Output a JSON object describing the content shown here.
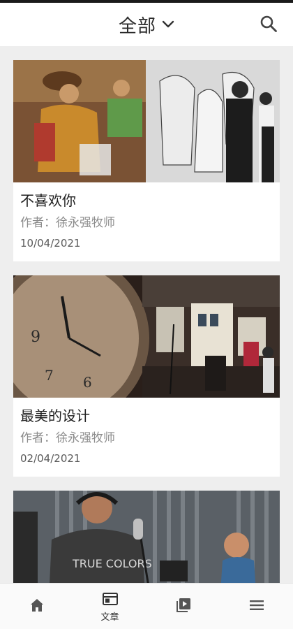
{
  "header": {
    "title": "全部",
    "dropdown_icon": "chevron-down-icon",
    "search_icon": "search-icon"
  },
  "articles": [
    {
      "title": "不喜欢你",
      "author": "作者：徐永强牧师",
      "date": "10/04/2021",
      "image": "mural-painting-photo"
    },
    {
      "title": "最美的设计",
      "author": "作者：徐永强牧师",
      "date": "02/04/2021",
      "image": "wall-clock-studio-photo"
    },
    {
      "title": "",
      "author": "",
      "date": "",
      "image": "recording-musicians-photo"
    }
  ],
  "bottom_nav": [
    {
      "icon": "home-icon",
      "label": "",
      "active": false
    },
    {
      "icon": "articles-icon",
      "label": "文章",
      "active": true
    },
    {
      "icon": "video-library-icon",
      "label": "",
      "active": false
    },
    {
      "icon": "menu-icon",
      "label": "",
      "active": false
    }
  ],
  "colors": {
    "background": "#eeeeee",
    "card": "#ffffff",
    "title_text": "#1e1e1e",
    "author_text": "#8c8c8c",
    "icon": "#555555"
  }
}
